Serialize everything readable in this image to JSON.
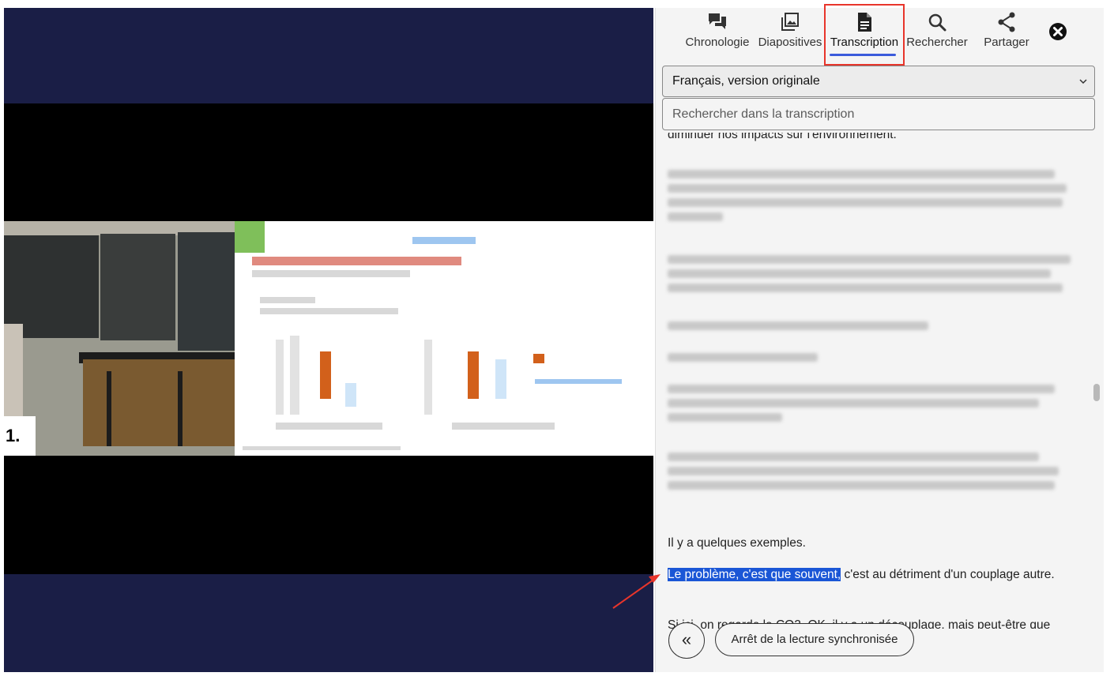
{
  "tabs": [
    {
      "label": "Chronologie",
      "icon": "chat-bubbles-icon"
    },
    {
      "label": "Diapositives",
      "icon": "slides-icon"
    },
    {
      "label": "Transcription",
      "icon": "document-icon",
      "active": true
    },
    {
      "label": "Rechercher",
      "icon": "search-icon"
    },
    {
      "label": "Partager",
      "icon": "share-icon"
    }
  ],
  "close_icon": "close-circle-icon",
  "language_select": {
    "value": "Français, version originale"
  },
  "transcript_search": {
    "placeholder": "Rechercher dans la transcription"
  },
  "transcript": {
    "cut_line": "diminuer nos impacts sur l'environnement.",
    "p_examples": "Il y a quelques exemples.",
    "p_problem_highlight": "Le problème, c'est que souvent,",
    "p_problem_rest": " c'est au détriment d'un couplage autre.",
    "p_last": "Si ici, on regarde le CO2. OK, il y a un découplage, mais peut-être que"
  },
  "slide_number": "1.",
  "controls": {
    "collapse_label": "«",
    "sync_label": "Arrêt de la lecture synchronisée"
  },
  "colors": {
    "accent": "#3b5bdb",
    "highlight": "#1a56d6",
    "annotation": "#e8352b",
    "video_bg": "#1a1e46"
  }
}
